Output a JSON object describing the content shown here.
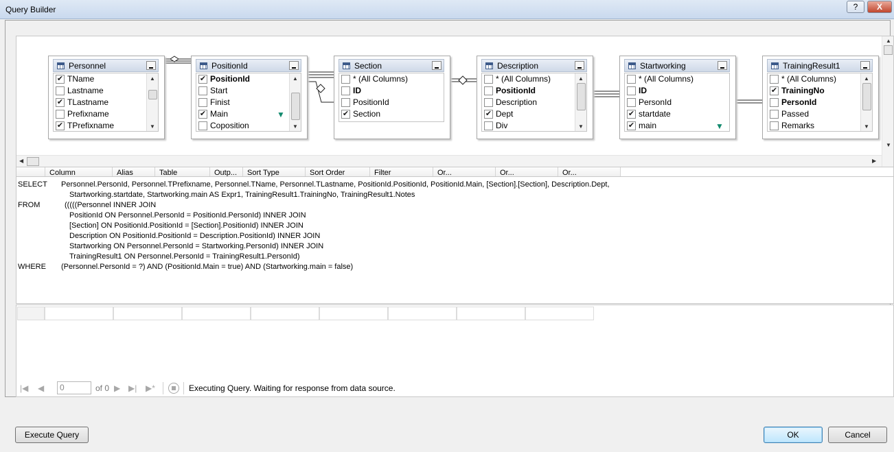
{
  "window": {
    "title": "Query Builder",
    "help_label": "?",
    "close_label": "X"
  },
  "tables": [
    {
      "name": "Personnel",
      "rows": [
        {
          "label": "TName",
          "checked": true,
          "key": false
        },
        {
          "label": "Lastname",
          "checked": false,
          "key": false
        },
        {
          "label": "TLastname",
          "checked": true,
          "key": false
        },
        {
          "label": "Prefixname",
          "checked": false,
          "key": false
        },
        {
          "label": "TPrefixname",
          "checked": true,
          "key": false
        }
      ]
    },
    {
      "name": "PositionId",
      "rows": [
        {
          "label": "PositionId",
          "checked": true,
          "key": true
        },
        {
          "label": "Start",
          "checked": false,
          "key": false
        },
        {
          "label": "Finist",
          "checked": false,
          "key": false
        },
        {
          "label": "Main",
          "checked": true,
          "key": false,
          "filter": true
        },
        {
          "label": "Coposition",
          "checked": false,
          "key": false
        }
      ]
    },
    {
      "name": "Section",
      "rows": [
        {
          "label": "* (All Columns)",
          "checked": false,
          "key": false
        },
        {
          "label": "ID",
          "checked": false,
          "key": true
        },
        {
          "label": "PositionId",
          "checked": false,
          "key": false
        },
        {
          "label": "Section",
          "checked": true,
          "key": false
        }
      ]
    },
    {
      "name": "Description",
      "rows": [
        {
          "label": "* (All Columns)",
          "checked": false,
          "key": false
        },
        {
          "label": "PositionId",
          "checked": false,
          "key": true
        },
        {
          "label": "Description",
          "checked": false,
          "key": false
        },
        {
          "label": "Dept",
          "checked": true,
          "key": false
        },
        {
          "label": "Div",
          "checked": false,
          "key": false
        }
      ]
    },
    {
      "name": "Startworking",
      "rows": [
        {
          "label": "* (All Columns)",
          "checked": false,
          "key": false
        },
        {
          "label": "ID",
          "checked": false,
          "key": true
        },
        {
          "label": "PersonId",
          "checked": false,
          "key": false
        },
        {
          "label": "startdate",
          "checked": true,
          "key": false
        },
        {
          "label": "main",
          "checked": true,
          "key": false,
          "filter": true
        }
      ]
    },
    {
      "name": "TrainingResult1",
      "rows": [
        {
          "label": "* (All Columns)",
          "checked": false,
          "key": false
        },
        {
          "label": "TrainingNo",
          "checked": true,
          "key": true
        },
        {
          "label": "PersonId",
          "checked": false,
          "key": true
        },
        {
          "label": "Passed",
          "checked": false,
          "key": false
        },
        {
          "label": "Remarks",
          "checked": false,
          "key": false
        }
      ]
    }
  ],
  "grid": {
    "headers": [
      "Column",
      "Alias",
      "Table",
      "Outp...",
      "Sort Type",
      "Sort Order",
      "Filter",
      "Or...",
      "Or...",
      "Or..."
    ]
  },
  "sql": {
    "lines": [
      {
        "kw": "SELECT",
        "text": "Personnel.PersonId, Personnel.TPrefixname, Personnel.TName, Personnel.TLastname, PositionId.PositionId, PositionId.Main, [Section].[Section], Description.Dept,"
      },
      {
        "kw": "",
        "text": "Startworking.startdate, Startworking.main AS Expr1, TrainingResult1.TrainingNo, TrainingResult1.Notes"
      },
      {
        "kw": "FROM",
        "text": "(((((Personnel INNER JOIN"
      },
      {
        "kw": "",
        "text": "PositionId ON Personnel.PersonId = PositionId.PersonId) INNER JOIN"
      },
      {
        "kw": "",
        "text": "[Section] ON PositionId.PositionId = [Section].PositionId) INNER JOIN"
      },
      {
        "kw": "",
        "text": "Description ON PositionId.PositionId = Description.PositionId) INNER JOIN"
      },
      {
        "kw": "",
        "text": "Startworking ON Personnel.PersonId = Startworking.PersonId) INNER JOIN"
      },
      {
        "kw": "",
        "text": "TrainingResult1 ON Personnel.PersonId = TrainingResult1.PersonId)"
      },
      {
        "kw": "WHERE",
        "text": "(Personnel.PersonId = ?) AND (PositionId.Main = true) AND (Startworking.main = false)"
      }
    ]
  },
  "navigator": {
    "position_value": "0",
    "of_label": "of 0",
    "status": "Executing Query. Waiting for response from data source."
  },
  "buttons": {
    "execute": "Execute Query",
    "ok": "OK",
    "cancel": "Cancel"
  },
  "icons": {
    "table": "table-icon",
    "filter": "funnel-icon",
    "minimize": "minimize-icon"
  }
}
